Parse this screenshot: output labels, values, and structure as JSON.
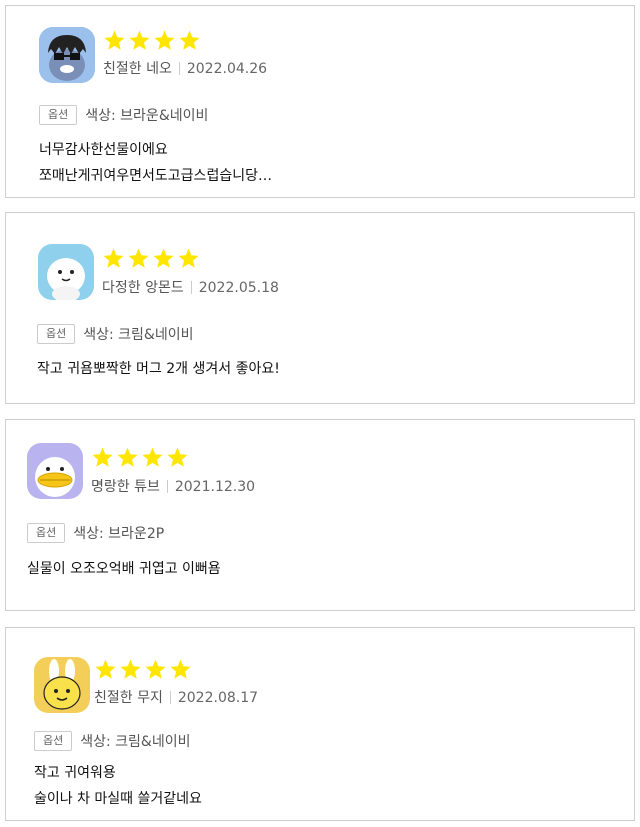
{
  "option_badge": "옵션",
  "colors": {
    "star": "#FFE600",
    "border": "#CFCFCF"
  },
  "rating_max": 5,
  "reviews": [
    {
      "avatar": "neo-icon",
      "rating": 4,
      "nickname": "친절한 네오",
      "date": "2022.04.26",
      "option": "색상: 브라운&네이비",
      "lines": [
        "너무감사한선물이에요",
        "쪼매난게귀여우면서도고급스럽습니당…"
      ]
    },
    {
      "avatar": "apeach-icon",
      "rating": 4,
      "nickname": "다정한 앙몬드",
      "date": "2022.05.18",
      "option": "색상: 크림&네이비",
      "lines": [
        "작고 귀욤뽀짝한 머그 2개 생겨서 좋아요!"
      ]
    },
    {
      "avatar": "tube-icon",
      "rating": 4,
      "nickname": "명랑한 튜브",
      "date": "2021.12.30",
      "option": "색상: 브라운2P",
      "lines": [
        "실물이 오조오억배 귀엽고 이뻐욤"
      ]
    },
    {
      "avatar": "muzi-icon",
      "rating": 4,
      "nickname": "친절한 무지",
      "date": "2022.08.17",
      "option": "색상: 크림&네이비",
      "lines": [
        "작고 귀여워용",
        "술이나 차 마실때 쓸거같네요"
      ]
    }
  ]
}
